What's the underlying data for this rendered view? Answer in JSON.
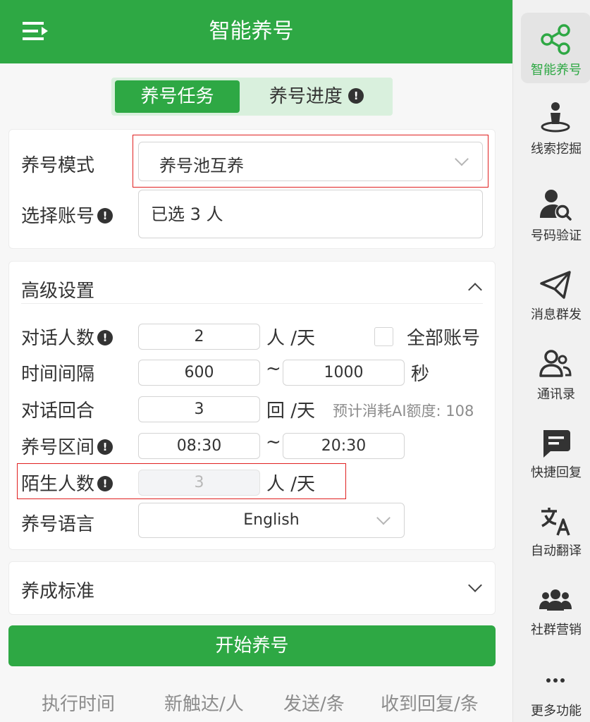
{
  "header": {
    "title": "智能养号"
  },
  "tabs": {
    "task": "养号任务",
    "progress": "养号进度"
  },
  "basic": {
    "mode_label": "养号模式",
    "mode_value": "养号池互养",
    "account_label": "选择账号",
    "account_value": "已选 3 人"
  },
  "advanced": {
    "title": "高级设置",
    "chat_count_label": "对话人数",
    "chat_count_value": "2",
    "chat_count_unit": "人 /天",
    "all_accounts_label": "全部账号",
    "interval_label": "时间间隔",
    "interval_min": "600",
    "interval_sep": "~",
    "interval_max": "1000",
    "interval_unit": "秒",
    "rounds_label": "对话回合",
    "rounds_value": "3",
    "rounds_unit": "回 /天",
    "estimate_text": "预计消耗AI额度: 108",
    "range_label": "养号区间",
    "range_start": "08:30",
    "range_sep": "~",
    "range_end": "20:30",
    "stranger_label": "陌生人数",
    "stranger_value": "3",
    "stranger_unit": "人 /天",
    "language_label": "养号语言",
    "language_value": "English"
  },
  "standard": {
    "title": "养成标准"
  },
  "start_button": "开始养号",
  "stats": {
    "exec_time": "执行时间",
    "new_reach": "新触达/人",
    "sent": "发送/条",
    "received": "收到回复/条"
  },
  "sidenav": {
    "active": "智能养号",
    "items": [
      "智能养号",
      "线索挖掘",
      "号码验证",
      "消息群发",
      "通讯录",
      "快捷回复",
      "自动翻译",
      "社群营销",
      "更多功能"
    ]
  },
  "colors": {
    "brand": "#2ea844",
    "brand_light": "#d9f0dd",
    "highlight_border": "#e02020"
  }
}
